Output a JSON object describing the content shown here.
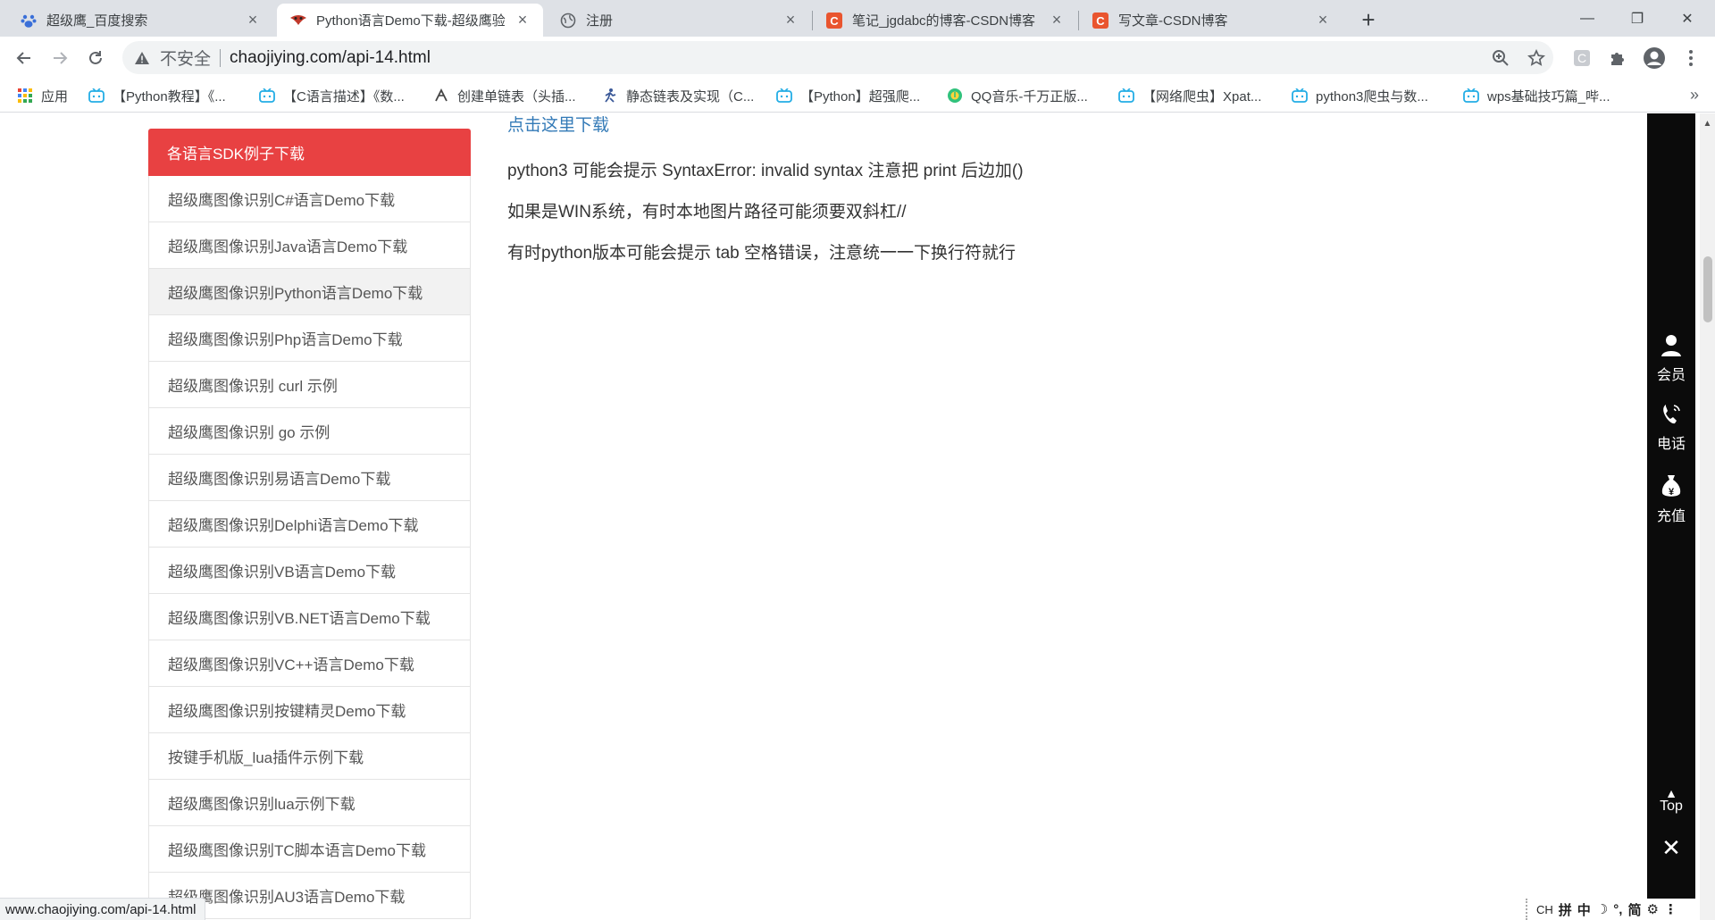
{
  "tabs": [
    {
      "title": "超级鹰_百度搜索",
      "icon": "baidu-paw-icon",
      "active": false
    },
    {
      "title": "Python语言Demo下载-超级鹰验",
      "icon": "chaojiying-eagle-icon",
      "active": true
    },
    {
      "title": "注册",
      "icon": "globe-icon",
      "active": false
    },
    {
      "title": "笔记_jgdabc的博客-CSDN博客",
      "icon": "csdn-c-icon",
      "active": false
    },
    {
      "title": "写文章-CSDN博客",
      "icon": "csdn-c-icon",
      "active": false
    }
  ],
  "new_tab_label": "+",
  "window_controls": {
    "minimize": "—",
    "restore": "❐",
    "close": "✕"
  },
  "omnibox": {
    "security_label": "不安全",
    "url": "chaojiying.com/api-14.html"
  },
  "bookmarks": [
    {
      "label": "应用",
      "icon": "apps-grid-icon"
    },
    {
      "label": "【Python教程】《...",
      "icon": "bilibili-tv-icon"
    },
    {
      "label": "【C语言描述】《数...",
      "icon": "bilibili-tv-icon"
    },
    {
      "label": "创建单链表（头插...",
      "icon": "link-arrow-icon"
    },
    {
      "label": "静态链表及实现（C...",
      "icon": "person-run-icon"
    },
    {
      "label": "【Python】超强爬...",
      "icon": "bilibili-tv-icon"
    },
    {
      "label": "QQ音乐-千万正版...",
      "icon": "qqmusic-icon"
    },
    {
      "label": "【网络爬虫】Xpat...",
      "icon": "bilibili-tv-icon"
    },
    {
      "label": "python3爬虫与数...",
      "icon": "bilibili-tv-icon"
    },
    {
      "label": "wps基础技巧篇_哔...",
      "icon": "bilibili-tv-icon"
    }
  ],
  "bookmarks_more": "»",
  "sidebar": {
    "header": "各语言SDK例子下载",
    "items": [
      "超级鹰图像识别C#语言Demo下载",
      "超级鹰图像识别Java语言Demo下载",
      "超级鹰图像识别Python语言Demo下载",
      "超级鹰图像识别Php语言Demo下载",
      "超级鹰图像识别 curl 示例",
      "超级鹰图像识别 go 示例",
      "超级鹰图像识别易语言Demo下载",
      "超级鹰图像识别Delphi语言Demo下载",
      "超级鹰图像识别VB语言Demo下载",
      "超级鹰图像识别VB.NET语言Demo下载",
      "超级鹰图像识别VC++语言Demo下载",
      "超级鹰图像识别按键精灵Demo下载",
      "按键手机版_lua插件示例下载",
      "超级鹰图像识别lua示例下载",
      "超级鹰图像识别TC脚本语言Demo下载",
      "超级鹰图像识别AU3语言Demo下载"
    ],
    "active_index": 2
  },
  "content": {
    "download_link": "点击这里下载",
    "paragraphs": [
      "python3 可能会提示 SyntaxError: invalid syntax  注意把 print 后边加()",
      "如果是WIN系统，有时本地图片路径可能须要双斜杠//",
      "有时python版本可能会提示 tab 空格错误，注意统一一下换行符就行"
    ]
  },
  "float_panel": {
    "member": "会员",
    "phone": "电话",
    "recharge": "充值",
    "top": "Top",
    "close": "✕"
  },
  "status_url": "www.chaojiying.com/api-14.html",
  "ime": [
    "CH",
    "拼",
    "中",
    "☽",
    "°,",
    "简",
    "⚙",
    "⋮"
  ],
  "colors": {
    "sidebar_header": "#e84142",
    "link": "#337ab7",
    "float_panel": "#0b0b0b",
    "tabstrip": "#dee1e6"
  }
}
